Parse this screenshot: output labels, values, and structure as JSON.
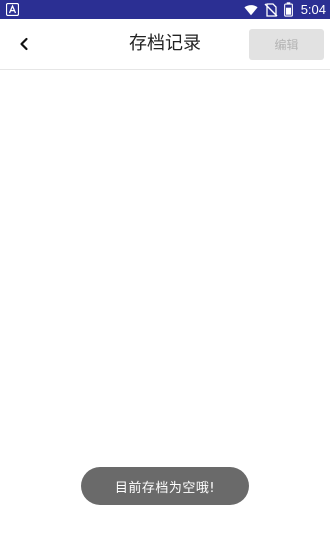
{
  "status_bar": {
    "time": "5:04",
    "background_color": "#2b2f93",
    "left_icon": "app-notification-icon",
    "icons": [
      "wifi-icon",
      "no-sim-icon",
      "battery-icon"
    ]
  },
  "app_bar": {
    "back_icon": "chevron-left-icon",
    "title": "存档记录",
    "edit_label": "编辑"
  },
  "content": {
    "items": []
  },
  "toast": {
    "message": "目前存档为空哦!"
  }
}
